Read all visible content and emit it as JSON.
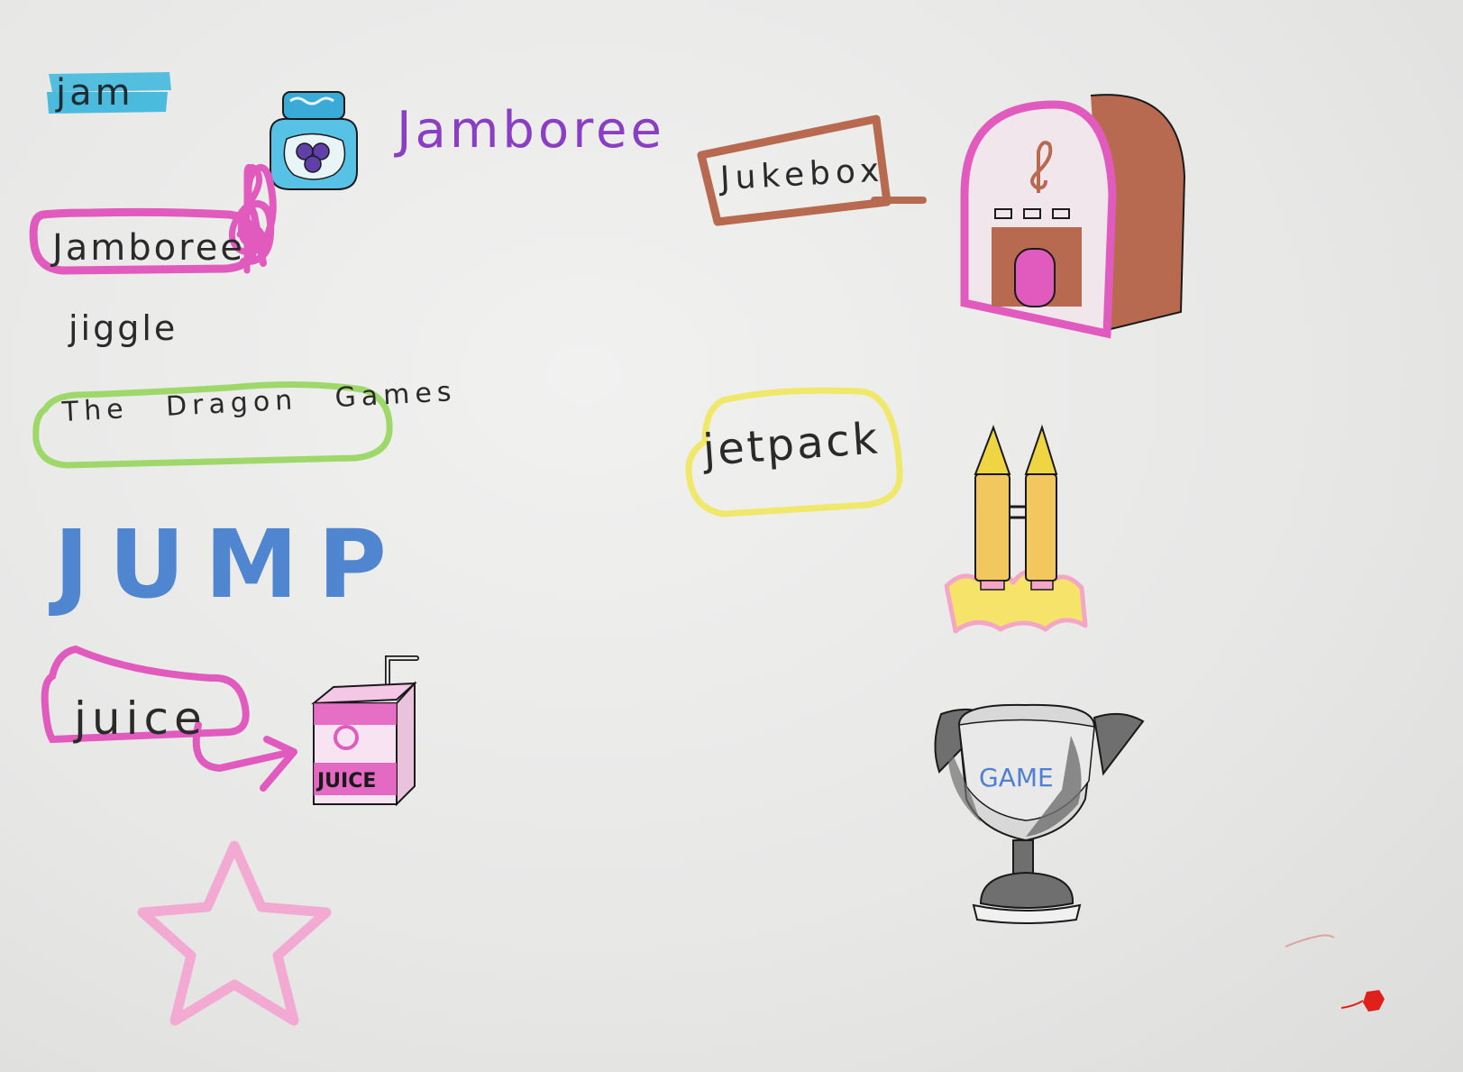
{
  "canvas": {
    "background": "#e9e9e8"
  },
  "words": {
    "jam": "jam",
    "jamboree_purple": "Jamboree",
    "jamboree_pink": "Jamboree",
    "jiggle": "jiggle",
    "dragon_games": "The Dragon Games",
    "jump": "JUMP",
    "juice": "juice",
    "jukebox": "Jukebox",
    "jetpack": "jetpack"
  },
  "drawings": {
    "juice_box_label": "JUICE",
    "trophy_label": "GAME"
  },
  "colors": {
    "jam_highlight": "#3ab6dc",
    "jamboree_purple": "#8a3fc2",
    "pink_marker": "#e05bbd",
    "green_marker": "#9fd86a",
    "jump_blue": "#4f86cf",
    "jukebox_brown": "#b76a4f",
    "jetpack_yellow": "#f0e86a",
    "star_pink": "#f2a9d2",
    "trophy_gray": "#6f6f6f",
    "trophy_text": "#4f7fd2",
    "red_dot": "#e0201b"
  },
  "icons": [
    "jam-jar-icon",
    "treble-clef-icon",
    "jukebox-icon",
    "jetpack-icon",
    "juice-box-icon",
    "arrow-icon",
    "star-icon",
    "trophy-icon"
  ]
}
